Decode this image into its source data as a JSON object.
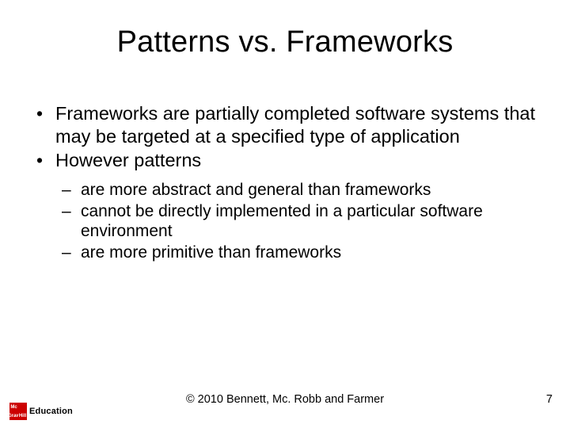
{
  "title": "Patterns vs. Frameworks",
  "bullets": [
    "Frameworks are partially completed software systems that may be targeted at a specified type of application",
    "However patterns"
  ],
  "sub_bullets": [
    "are more abstract and general than frameworks",
    "cannot be directly implemented in a particular software environment",
    "are more primitive than frameworks"
  ],
  "footer": {
    "copyright": "© 2010 Bennett, Mc. Robb and Farmer",
    "page_number": "7"
  },
  "logo": {
    "brand_text": "Education",
    "mark_cells": [
      "Mc",
      "",
      "Graw",
      "Hill"
    ]
  }
}
